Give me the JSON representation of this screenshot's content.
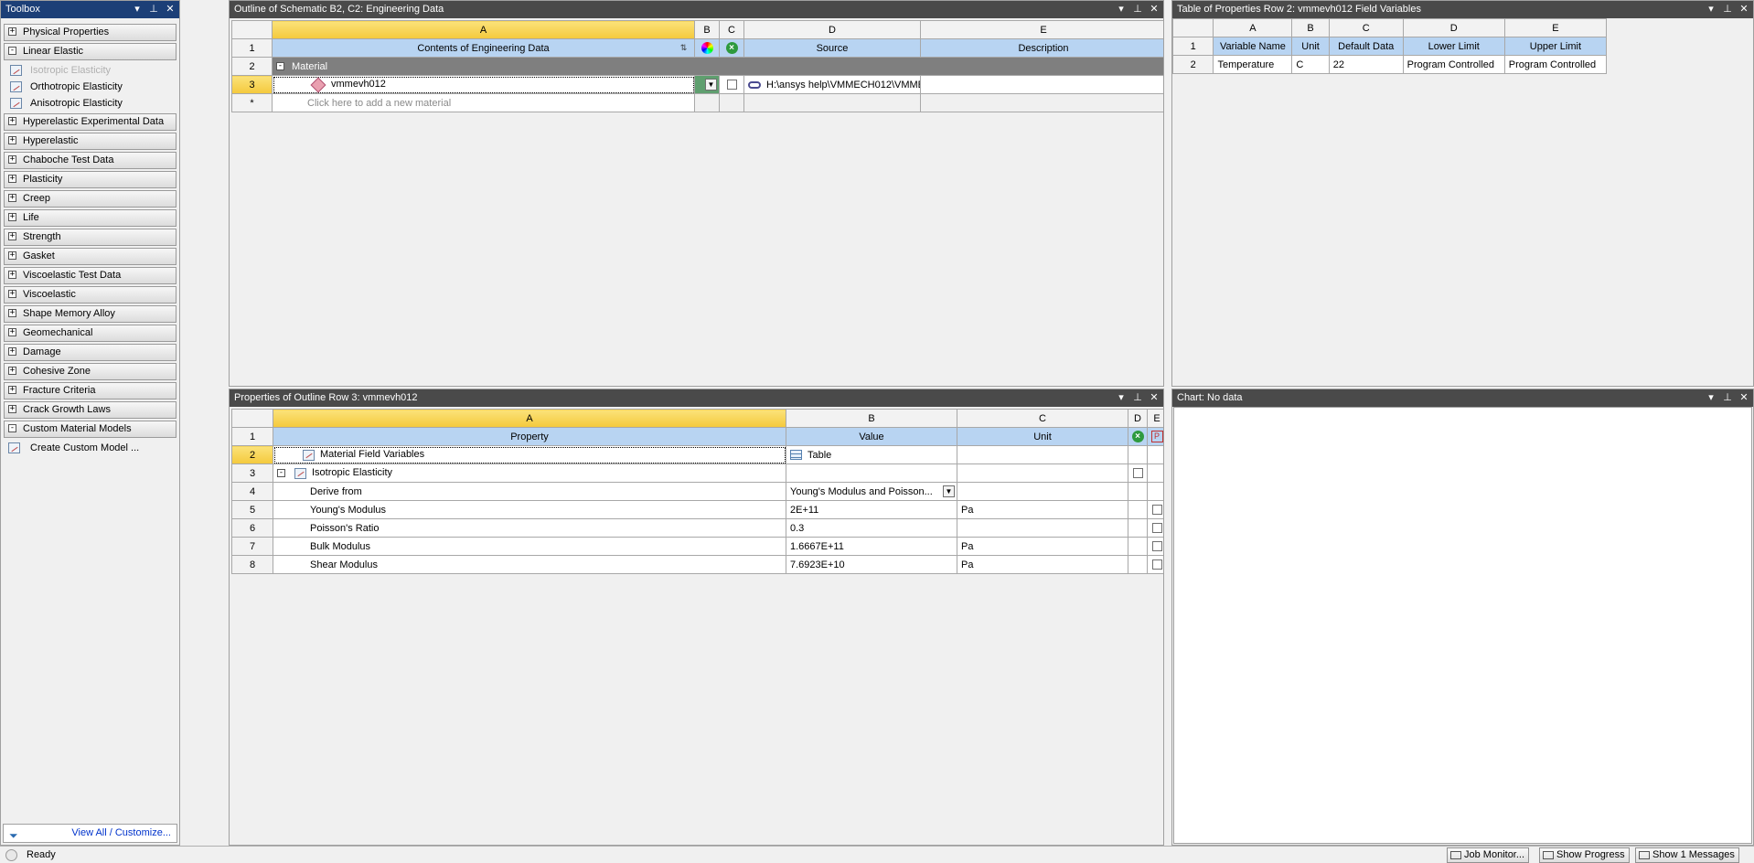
{
  "toolbox": {
    "title": "Toolbox",
    "categories_top": [
      {
        "label": "Physical Properties",
        "state": "+"
      },
      {
        "label": "Linear Elastic",
        "state": "-"
      }
    ],
    "linear_elastic_items": [
      {
        "label": "Isotropic Elasticity",
        "disabled": true
      },
      {
        "label": "Orthotropic Elasticity",
        "disabled": false
      },
      {
        "label": "Anisotropic Elasticity",
        "disabled": false
      }
    ],
    "categories": [
      "Hyperelastic Experimental Data",
      "Hyperelastic",
      "Chaboche Test Data",
      "Plasticity",
      "Creep",
      "Life",
      "Strength",
      "Gasket",
      "Viscoelastic Test Data",
      "Viscoelastic",
      "Shape Memory Alloy",
      "Geomechanical",
      "Damage",
      "Cohesive Zone",
      "Fracture Criteria",
      "Crack Growth Laws"
    ],
    "custom_category": "Custom Material Models",
    "custom_item": "Create Custom Model ...",
    "footer_link": "View All / Customize..."
  },
  "outline": {
    "title": "Outline of Schematic B2, C2: Engineering Data",
    "col_letters": [
      "A",
      "B",
      "C",
      "D",
      "E"
    ],
    "row_numbers": [
      "1",
      "2",
      "3",
      "*"
    ],
    "headers": {
      "contents": "Contents of Engineering Data",
      "source": "Source",
      "description": "Description"
    },
    "group_label": "Material",
    "material_name": "vmmevh012",
    "material_source": "H:\\ansys help\\VMMECH012\\VMME(",
    "add_placeholder": "Click here to add a new material"
  },
  "props_table": {
    "title": "Table of Properties Row 2: vmmevh012 Field Variables",
    "col_letters": [
      "A",
      "B",
      "C",
      "D",
      "E"
    ],
    "headers": [
      "Variable Name",
      "Unit",
      "Default Data",
      "Lower Limit",
      "Upper Limit"
    ],
    "rows": [
      {
        "num": "1"
      },
      {
        "num": "2",
        "cells": [
          "Temperature",
          "C",
          "22",
          "Program Controlled",
          "Program Controlled"
        ]
      }
    ]
  },
  "properties": {
    "title": "Properties of Outline Row 3: vmmevh012",
    "col_letters": [
      "A",
      "B",
      "C",
      "D",
      "E"
    ],
    "headers": {
      "property": "Property",
      "value": "Value",
      "unit": "Unit"
    },
    "rows": [
      {
        "num": "2",
        "property": "Material Field Variables",
        "value": "Table",
        "unit": ""
      },
      {
        "num": "3",
        "property": "Isotropic Elasticity",
        "value": "",
        "unit": ""
      },
      {
        "num": "4",
        "property": "Derive from",
        "value": "Young's Modulus and Poisson...",
        "unit": ""
      },
      {
        "num": "5",
        "property": "Young's Modulus",
        "value": "2E+11",
        "unit": "Pa"
      },
      {
        "num": "6",
        "property": "Poisson's Ratio",
        "value": "0.3",
        "unit": ""
      },
      {
        "num": "7",
        "property": "Bulk Modulus",
        "value": "1.6667E+11",
        "unit": "Pa"
      },
      {
        "num": "8",
        "property": "Shear Modulus",
        "value": "7.6923E+10",
        "unit": "Pa"
      }
    ]
  },
  "chart": {
    "title": "Chart: No data"
  },
  "statusbar": {
    "status": "Ready",
    "job_monitor": "Job Monitor...",
    "show_progress": "Show Progress",
    "show_messages": "Show 1 Messages"
  },
  "controls": {
    "dropdown": "▾",
    "pin": "⊥",
    "close": "✕"
  }
}
